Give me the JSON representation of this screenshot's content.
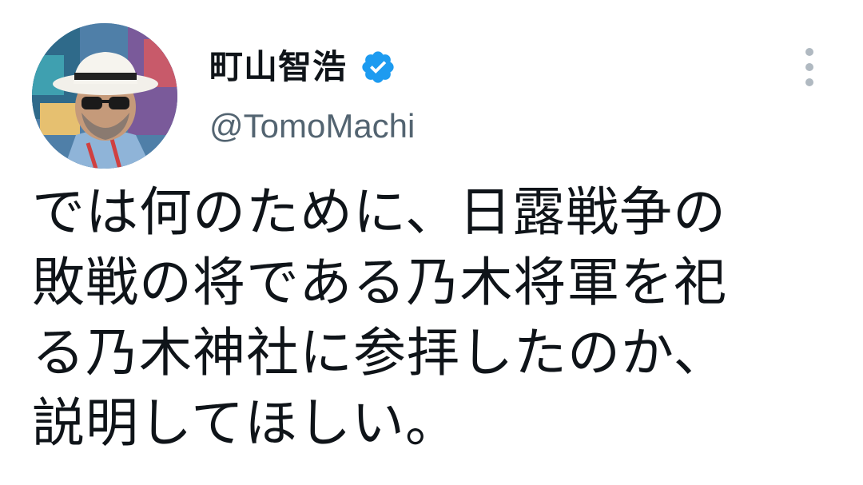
{
  "author": {
    "display_name": "町山智浩",
    "handle": "@TomoMachi",
    "verified_icon": "verified-badge-icon",
    "avatar_icon": "avatar"
  },
  "menu": {
    "icon": "more-vertical-icon"
  },
  "tweet": {
    "lines": [
      "では何のために、日露戦争の",
      "敗戦の将である乃木将軍を祀",
      "る乃木神社に参拝したのか、",
      "説明してほしい。"
    ]
  },
  "colors": {
    "text": "#0f1419",
    "secondary_text": "#536471",
    "verified_blue": "#1d9bf0",
    "menu_dots": "#b0b9c1"
  }
}
